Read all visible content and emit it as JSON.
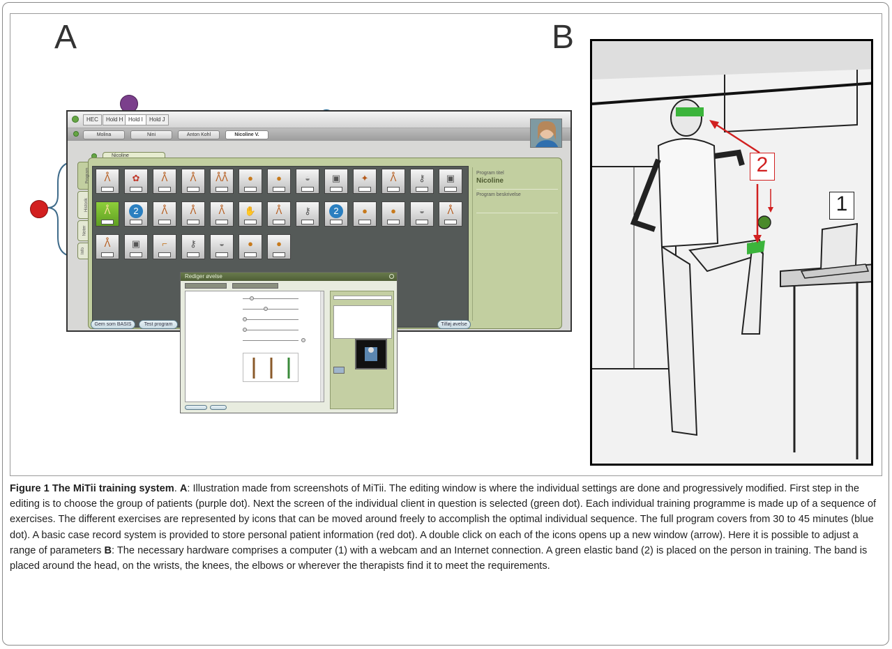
{
  "panels": {
    "a_label": "A",
    "b_label": "B"
  },
  "app": {
    "group_tabs": [
      "HEC",
      "Hold H",
      "Hold I",
      "Hold J"
    ],
    "client_tabs": [
      "Molina",
      "Nini",
      "Anton Kohl",
      "Nicoline V."
    ],
    "client_tab_active": "Nicoline",
    "side_tabs": [
      "Program",
      "Historik",
      "Noter",
      "Info"
    ],
    "exercise_icons_row1": [
      "figure",
      "colorful",
      "figure",
      "figure",
      "figure-group",
      "ball",
      "ball",
      "disc",
      "box",
      "puzzle",
      "figure",
      "key",
      "box"
    ],
    "exercise_icons_row2": [
      "figure-selected",
      "2",
      "figure",
      "figure",
      "figure",
      "hand",
      "figure",
      "key",
      "2",
      "ball",
      "ball",
      "disc",
      "figure"
    ],
    "exercise_icons_row3": [
      "figure",
      "box",
      "boot",
      "key",
      "disc",
      "ball",
      "ball"
    ],
    "program_label": "Program titel",
    "program_title": "Nicoline",
    "program_description_label": "Program beskrivelse",
    "buttons": {
      "save": "Gem som BASIS",
      "test": "Test program",
      "add": "Tilføj øvelse"
    },
    "dialog_title": "Rediger øvelse",
    "dot_colors": {
      "purple": "#7b3f8c",
      "green": "#2aa02a",
      "blue": "#1e8fd8",
      "red": "#d21f1f"
    }
  },
  "photo_callouts": {
    "one": "1",
    "two": "2"
  },
  "caption": {
    "figure_label": "Figure 1 The MiTii training system",
    "a_marker": "A",
    "a_text": ": Illustration made from screenshots of MiTii. The editing window is where the individual settings are done and progressively modified. First step in the editing is to choose the group of patients (purple dot). Next the screen of the individual client in question is selected (green dot). Each individual training programme is made up of a sequence of exercises. The different exercises are represented by icons that can be moved around freely to accomplish the optimal individual sequence. The full program covers from 30 to 45 minutes (blue dot). A basic case record system is provided to store personal patient information (red dot). A double click on each of the icons opens up a new window (arrow). Here it is possible to adjust a range of parameters ",
    "b_marker": "B",
    "b_text": ": The necessary hardware comprises a computer (1) with a webcam and an Internet connection. A green elastic band (2) is placed on the person in training. The band is placed around the head, on the wrists, the knees, the elbows or wherever the therapists find it to meet the requirements."
  }
}
